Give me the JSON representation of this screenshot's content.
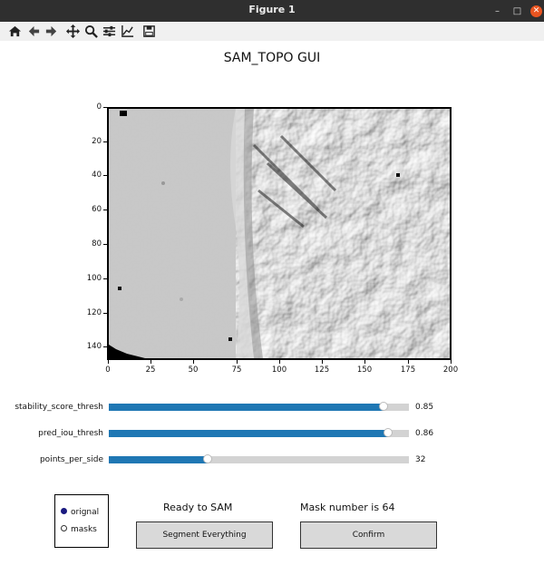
{
  "window": {
    "title": "Figure 1"
  },
  "window_controls": {
    "minimize": "–",
    "maximize": "□",
    "close": "✕"
  },
  "toolbar": {
    "icons": [
      "home-icon",
      "back-arrow-icon",
      "forward-arrow-icon",
      "pan-icon",
      "zoom-icon",
      "configure-subplots-icon",
      "edit-axes-icon",
      "save-icon"
    ]
  },
  "figure": {
    "title": "SAM_TOPO GUI",
    "y_ticks": [
      "0",
      "20",
      "40",
      "60",
      "80",
      "100",
      "120",
      "140"
    ],
    "x_ticks": [
      "0",
      "25",
      "50",
      "75",
      "100",
      "125",
      "150",
      "175",
      "200"
    ],
    "x_range": [
      0,
      200
    ],
    "y_range": [
      0,
      147
    ]
  },
  "sliders": [
    {
      "label": "stability_score_thresh",
      "value": "0.85",
      "fraction": 0.915
    },
    {
      "label": "pred_iou_thresh",
      "value": "0.86",
      "fraction": 0.93
    },
    {
      "label": "points_per_side",
      "value": "32",
      "fraction": 0.33
    }
  ],
  "radio": {
    "options": [
      "orignal",
      "masks"
    ],
    "selected": "orignal"
  },
  "status": {
    "left": "Ready to SAM",
    "right": "Mask number is 64"
  },
  "buttons": {
    "segment": "Segment Everything",
    "confirm": "Confirm"
  },
  "colors": {
    "slider_fill": "#1f77b4",
    "slider_track": "#d3d3d3",
    "button_bg": "#d9d9d9",
    "titlebar": "#2f2f2f",
    "close": "#e95420"
  }
}
